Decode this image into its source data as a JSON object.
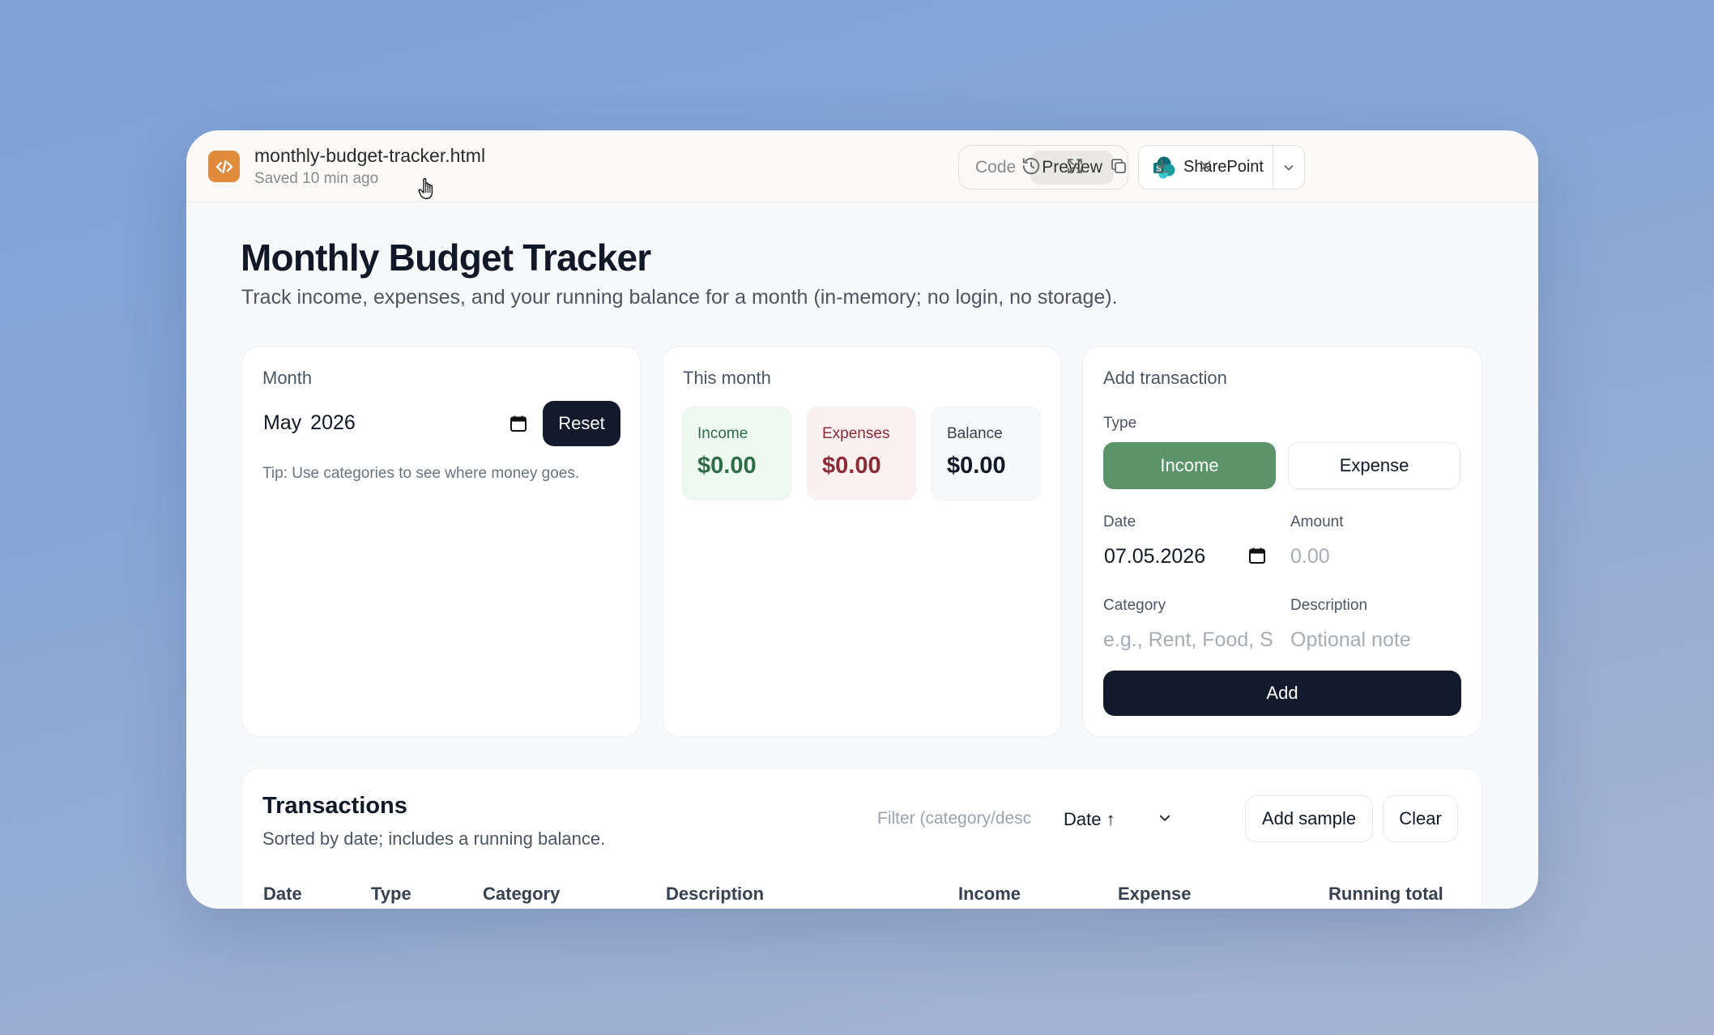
{
  "titlebar": {
    "file_name": "monthly-budget-tracker.html",
    "status": "Saved 10 min ago",
    "view_tabs": [
      {
        "label": "Code",
        "active": false
      },
      {
        "label": "Preview",
        "active": true
      }
    ],
    "share_target": "SharePoint"
  },
  "page": {
    "title": "Monthly Budget Tracker",
    "subtitle": "Track income, expenses, and your running balance for a month (in-memory; no login, no storage)."
  },
  "month_card": {
    "label": "Month",
    "value": "May 2026",
    "reset_label": "Reset",
    "tip": "Tip: Use categories to see where money goes."
  },
  "summary_card": {
    "label": "This month",
    "income": {
      "label": "Income",
      "value": "$0.00",
      "color": "#2f6b45"
    },
    "expenses": {
      "label": "Expenses",
      "value": "$0.00",
      "color": "#8b2b36"
    },
    "balance": {
      "label": "Balance",
      "value": "$0.00",
      "color": "#111827"
    }
  },
  "add_card": {
    "label": "Add transaction",
    "type_label": "Type",
    "type_options": [
      "Income",
      "Expense"
    ],
    "selected_type": "Income",
    "date_label": "Date",
    "date_value": "07.05.2026",
    "amount_label": "Amount",
    "amount_placeholder": "0.00",
    "category_label": "Category",
    "category_placeholder": "e.g., Rent, Food, S",
    "description_label": "Description",
    "description_placeholder": "Optional note",
    "add_label": "Add"
  },
  "transactions": {
    "title": "Transactions",
    "subtitle": "Sorted by date; includes a running balance.",
    "filter_placeholder": "Filter (category/descript",
    "sort_value": "Date ↑",
    "add_sample_label": "Add sample",
    "clear_label": "Clear",
    "columns": [
      "Date",
      "Type",
      "Category",
      "Description",
      "Income",
      "Expense",
      "Running total"
    ]
  },
  "colors": {
    "accent_green": "#5a9468",
    "dark_button": "#131a2b",
    "file_icon": "#e08a3c"
  }
}
